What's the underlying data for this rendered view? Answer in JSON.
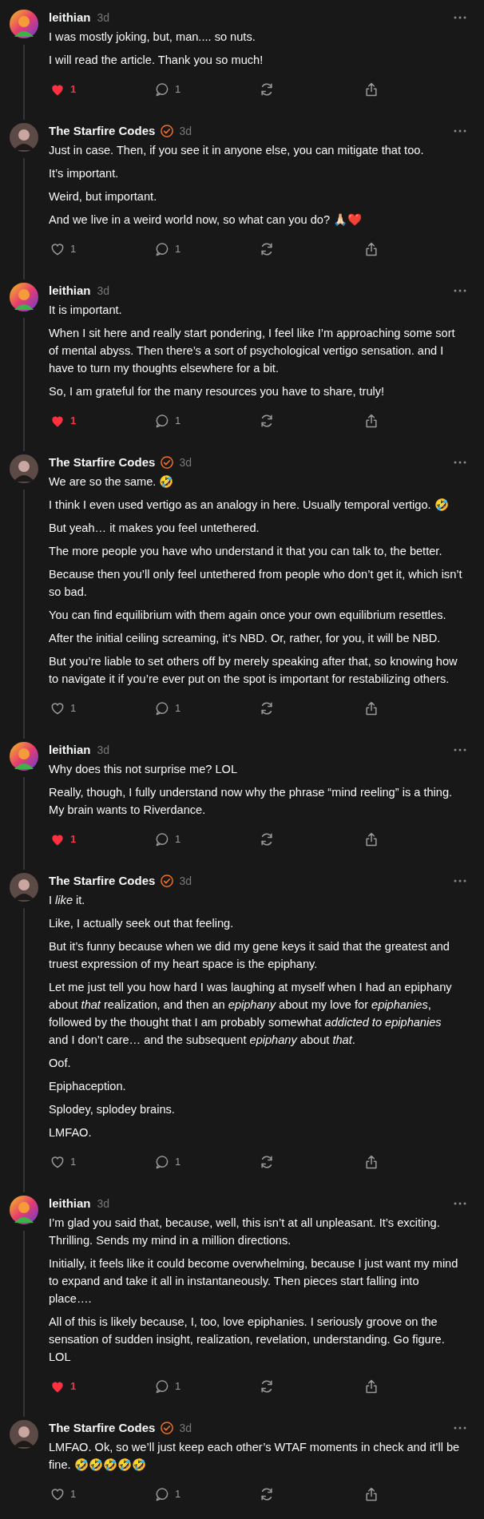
{
  "posts": [
    {
      "author": "leithian",
      "kind": "colorful",
      "verified": false,
      "time": "3d",
      "paragraphs": [
        "I was mostly joking, but, man.... so nuts.",
        "I will read the article. Thank you so much!"
      ],
      "liked": true,
      "likes": "1",
      "replies": "1"
    },
    {
      "author": "The Starfire Codes",
      "kind": "photo",
      "verified": true,
      "time": "3d",
      "paragraphs": [
        "Just in case. Then, if you see it in anyone else, you can mitigate that too.",
        "It’s important.",
        "Weird, but important.",
        "And we live in a weird world now, so what can you do? 🙏🏻❤️"
      ],
      "liked": false,
      "likes": "1",
      "replies": "1"
    },
    {
      "author": "leithian",
      "kind": "colorful",
      "verified": false,
      "time": "3d",
      "paragraphs": [
        "It is important.",
        "When I sit here and really start pondering, I feel like I’m approaching some sort of mental abyss. Then there’s a sort of psychological vertigo sensation. and I have to turn my thoughts elsewhere for a bit.",
        "So, I am grateful for the many resources you have to share, truly!"
      ],
      "liked": true,
      "likes": "1",
      "replies": "1"
    },
    {
      "author": "The Starfire Codes",
      "kind": "photo",
      "verified": true,
      "time": "3d",
      "paragraphs": [
        "We are so the same. 🤣",
        "I think I even used vertigo as an analogy in here. Usually temporal vertigo. 🤣",
        "But yeah… it makes you feel untethered.",
        "The more people you have who understand it that you can talk to, the better.",
        "Because then you’ll only feel untethered from people who don’t get it, which isn’t so bad.",
        "You can find equilibrium with them again once your own equilibrium resettles.",
        "After the initial ceiling screaming, it’s NBD. Or, rather, for you, it will be NBD.",
        "But you’re liable to set others off by merely speaking after that, so knowing how to navigate it if you’re ever put on the spot is important for restabilizing others."
      ],
      "liked": false,
      "likes": "1",
      "replies": "1"
    },
    {
      "author": "leithian",
      "kind": "colorful",
      "verified": false,
      "time": "3d",
      "paragraphs": [
        "Why does this not surprise me? LOL",
        "Really, though, I fully understand now why the phrase “mind reeling” is a thing. My brain wants to Riverdance."
      ],
      "liked": true,
      "likes": "1",
      "replies": "1"
    },
    {
      "author": "The Starfire Codes",
      "kind": "photo",
      "verified": true,
      "time": "3d",
      "paragraphs": [
        "I *like* it.",
        "Like, I actually seek out that feeling.",
        "But it’s funny because when we did my gene keys it said that the greatest and truest expression of my heart space is the epiphany.",
        "Let me just tell you how hard I was laughing at myself when I had an epiphany about *that* realization, and then an *epiphany* about my love for *epiphanies*, followed by the thought that I am probably somewhat *addicted to epiphanies* and I don’t care… and the subsequent *epiphany* about *that*.",
        "Oof.",
        "Epiphaception.",
        "Splodey, splodey brains.",
        "LMFAO."
      ],
      "liked": false,
      "likes": "1",
      "replies": "1"
    },
    {
      "author": "leithian",
      "kind": "colorful",
      "verified": false,
      "time": "3d",
      "paragraphs": [
        "I’m glad you said that, because, well, this isn’t at all unpleasant. It’s exciting. Thrilling. Sends my mind in a million directions.",
        "Initially, it feels like it could become overwhelming, because I just want my mind to expand and take it all in instantaneously. Then pieces start falling into place….",
        "All of this is likely because, I, too, love epiphanies. I seriously groove on the sensation of sudden insight, realization, revelation, understanding. Go figure. LOL"
      ],
      "liked": true,
      "likes": "1",
      "replies": "1"
    },
    {
      "author": "The Starfire Codes",
      "kind": "photo",
      "verified": true,
      "time": "3d",
      "paragraphs": [
        "LMFAO. Ok, so we’ll just keep each other’s WTAF moments in check and it’ll be fine. 🤣🤣🤣🤣🤣"
      ],
      "liked": false,
      "likes": "1",
      "replies": "1"
    }
  ]
}
